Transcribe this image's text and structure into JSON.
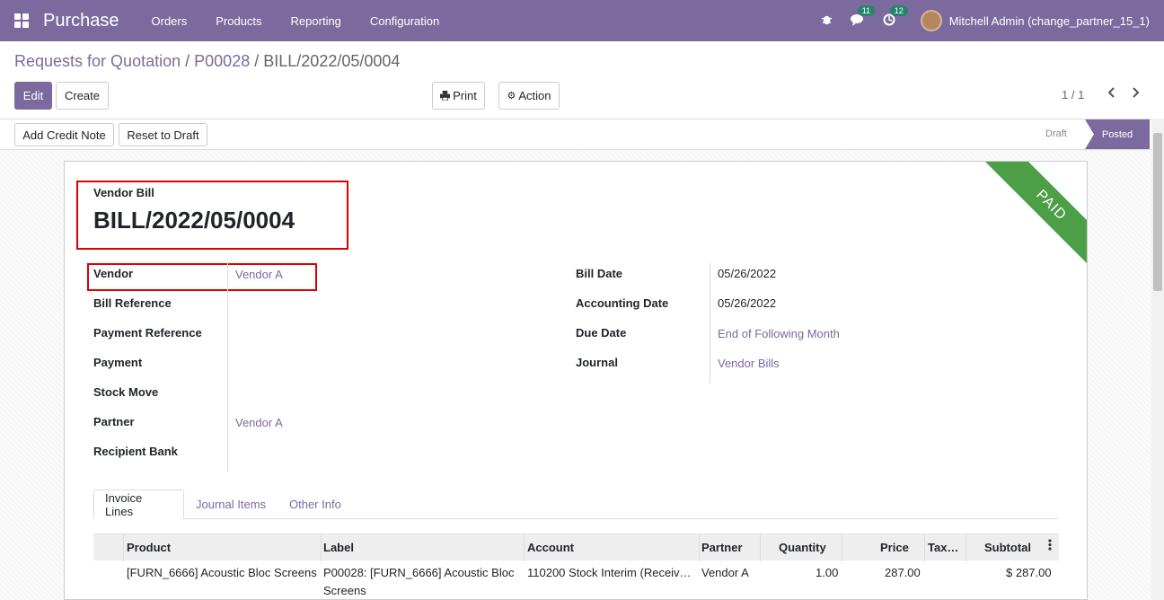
{
  "navbar": {
    "app_name": "Purchase",
    "menu": [
      "Orders",
      "Products",
      "Reporting",
      "Configuration"
    ],
    "messages_badge": "11",
    "activities_badge": "12",
    "user": "Mitchell Admin (change_partner_15_1)"
  },
  "breadcrumb": {
    "root": "Requests for Quotation",
    "sep1": "/",
    "order": "P00028",
    "sep2": "/",
    "current": "BILL/2022/05/0004"
  },
  "buttons": {
    "edit": "Edit",
    "create": "Create",
    "print": "Print",
    "action": "Action",
    "add_credit_note": "Add Credit Note",
    "reset_to_draft": "Reset to Draft"
  },
  "pager": {
    "value": "1 / 1"
  },
  "status": {
    "draft": "Draft",
    "posted": "Posted"
  },
  "ribbon": "PAID",
  "document": {
    "type": "Vendor Bill",
    "name": "BILL/2022/05/0004"
  },
  "left_fields": {
    "vendor_label": "Vendor",
    "vendor_value": "Vendor A",
    "bill_reference_label": "Bill Reference",
    "payment_reference_label": "Payment Reference",
    "payment_label": "Payment",
    "stock_move_label": "Stock Move",
    "partner_label": "Partner",
    "partner_value": "Vendor A",
    "recipient_bank_label": "Recipient Bank"
  },
  "right_fields": {
    "bill_date_label": "Bill Date",
    "bill_date_value": "05/26/2022",
    "accounting_date_label": "Accounting Date",
    "accounting_date_value": "05/26/2022",
    "due_date_label": "Due Date",
    "due_date_value": "End of Following Month",
    "journal_label": "Journal",
    "journal_value": "Vendor Bills"
  },
  "tabs": [
    "Invoice Lines",
    "Journal Items",
    "Other Info"
  ],
  "lines_table": {
    "columns": [
      "Product",
      "Label",
      "Account",
      "Partner",
      "Quantity",
      "Price",
      "Tax…",
      "Subtotal"
    ],
    "rows": [
      {
        "product": "[FURN_6666] Acoustic Bloc Screens",
        "label_line1": "P00028: [FURN_6666] Acoustic Bloc",
        "label_line2": "Screens",
        "account": "110200 Stock Interim (Receiv…",
        "partner": "Vendor A",
        "quantity": "1.00",
        "price": "287.00",
        "subtotal": "$ 287.00"
      }
    ]
  }
}
